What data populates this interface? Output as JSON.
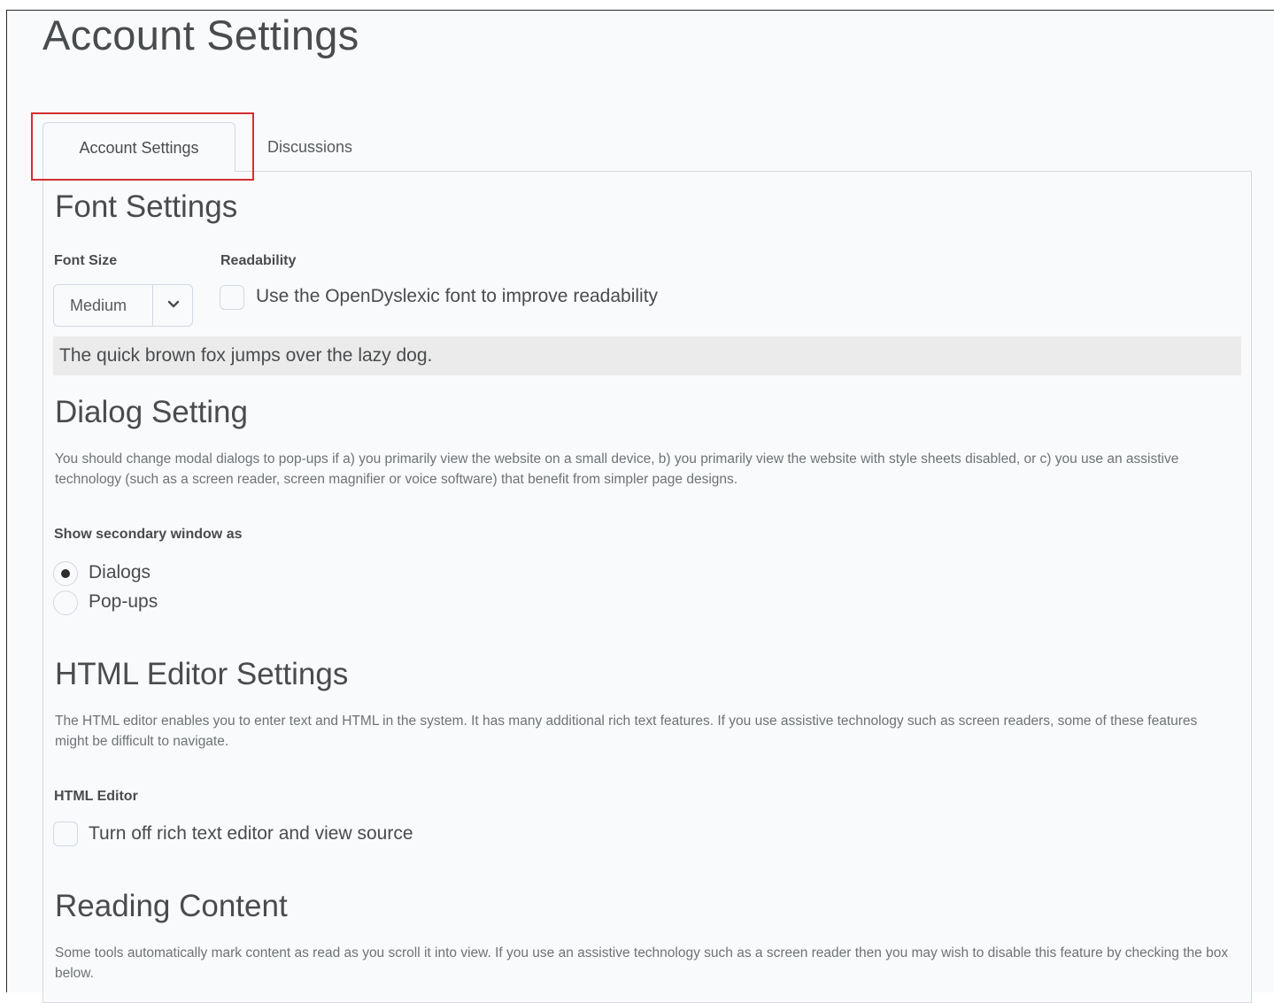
{
  "page": {
    "title": "Account Settings"
  },
  "tabs": [
    {
      "label": "Account Settings",
      "selected": true
    },
    {
      "label": "Discussions",
      "selected": false
    }
  ],
  "font_settings": {
    "heading": "Font Settings",
    "font_size_label": "Font Size",
    "font_size_value": "Medium",
    "readability_label": "Readability",
    "opendyslexic_label": "Use the OpenDyslexic font to improve readability",
    "opendyslexic_checked": false,
    "preview_text": "The quick brown fox jumps over the lazy dog."
  },
  "dialog_setting": {
    "heading": "Dialog Setting",
    "description": "You should change modal dialogs to pop-ups if a) you primarily view the website on a small device, b) you primarily view the website with style sheets disabled, or c) you use an assistive technology (such as a screen reader, screen magnifier or voice software) that benefit from simpler page designs.",
    "show_label": "Show secondary window as",
    "options": [
      {
        "label": "Dialogs",
        "selected": true
      },
      {
        "label": "Pop-ups",
        "selected": false
      }
    ]
  },
  "html_editor_settings": {
    "heading": "HTML Editor Settings",
    "description": "The HTML editor enables you to enter text and HTML in the system. It has many additional rich text features. If you use assistive technology such as screen readers, some of these features might be difficult to navigate.",
    "editor_label": "HTML Editor",
    "rich_text_off_label": "Turn off rich text editor and view source",
    "rich_text_off_checked": false
  },
  "reading_content": {
    "heading": "Reading Content",
    "description": "Some tools automatically mark content as read as you scroll it into view. If you use an assistive technology such as a screen reader then you may wish to disable this feature by checking the box below."
  },
  "icons": {
    "select_chevron": "chevron-down-icon"
  },
  "colors": {
    "highlight_border": "#d32f2f",
    "text_primary": "#494c4e",
    "text_secondary": "#6e7376",
    "preview_background": "#ebebeb",
    "border": "#d3d9e3"
  }
}
